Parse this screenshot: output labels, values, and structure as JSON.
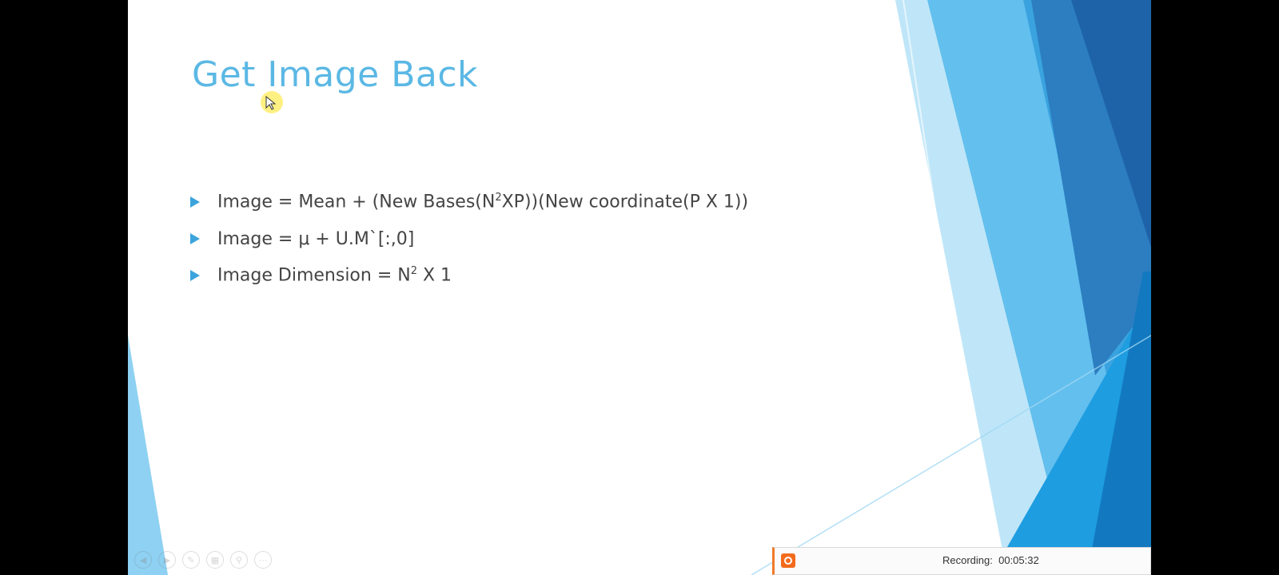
{
  "slide": {
    "title": "Get Image Back",
    "bullets": [
      {
        "pre": "Image = Mean + (New Bases(N",
        "sup": "2",
        "post": "XP))(New coordinate(P X 1))"
      },
      {
        "text": "Image = μ + U.M`[:,0]"
      },
      {
        "pre": "Image Dimension = N",
        "sup": "2",
        "post": " X 1"
      }
    ]
  },
  "recording": {
    "label": "Recording:",
    "time": "00:05:32"
  },
  "colors": {
    "title": "#5bb8e4",
    "bullet_arrow": "#3ca4dc",
    "recording_icon": "#f36b1c"
  },
  "icons": [
    "prev-icon",
    "play-icon",
    "pen-icon",
    "slides-icon",
    "zoom-icon",
    "more-icon"
  ]
}
